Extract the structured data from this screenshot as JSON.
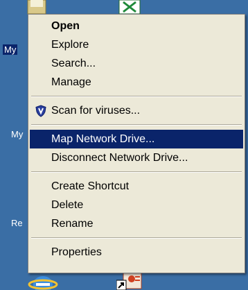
{
  "desktop": {
    "icon_labels": [
      "My",
      "My",
      "Re"
    ]
  },
  "menu": {
    "items": [
      {
        "label": "Open",
        "bold": true
      },
      {
        "label": "Explore"
      },
      {
        "label": "Search..."
      },
      {
        "label": "Manage"
      },
      {
        "label": "Scan for viruses...",
        "icon": "antivirus-shield-icon"
      },
      {
        "label": "Map Network Drive...",
        "highlighted": true
      },
      {
        "label": "Disconnect Network Drive..."
      },
      {
        "label": "Create Shortcut"
      },
      {
        "label": "Delete"
      },
      {
        "label": "Rename"
      },
      {
        "label": "Properties"
      }
    ]
  },
  "colors": {
    "desktop_bg": "#3a6ea5",
    "menu_bg": "#ece9d8",
    "highlight": "#0a246a"
  }
}
